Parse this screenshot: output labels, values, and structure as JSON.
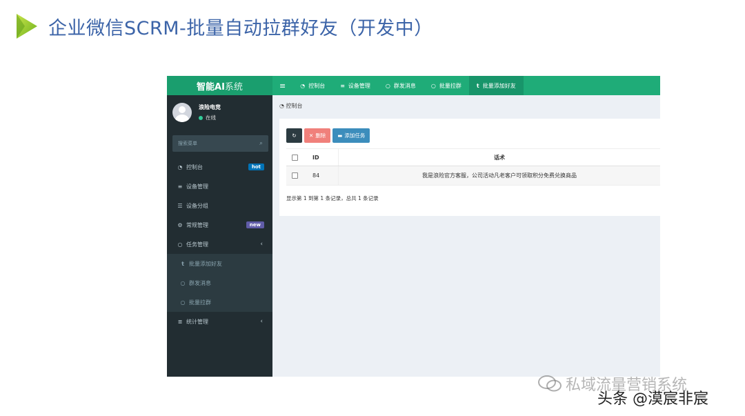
{
  "slide": {
    "title": "企业微信SCRM-批量自动拉群好友（开发中）",
    "accent": "#8fc31f"
  },
  "app": {
    "logo_bold": "智能AI",
    "logo_light": "系统",
    "user": {
      "name": "浪险电竞",
      "status": "在线"
    },
    "search_placeholder": "搜索菜单",
    "sidebar": {
      "dashboard": "控制台",
      "dashboard_badge": "hot",
      "device_mgmt": "设备管理",
      "device_group": "设备分组",
      "general_mgmt": "常规管理",
      "general_badge": "new",
      "task_mgmt": "任务管理",
      "sub_batch_add": "批量添加好友",
      "sub_group_msg": "群发消息",
      "sub_batch_pull": "批量拉群",
      "stats_mgmt": "统计管理"
    },
    "topbar": {
      "tabs": [
        "控制台",
        "设备管理",
        "群发消息",
        "批量拉群",
        "批量添加好友"
      ]
    },
    "breadcrumb": "控制台",
    "toolbar": {
      "delete": "删除",
      "add": "添加任务"
    },
    "table": {
      "headers": {
        "id": "ID",
        "script": "话术"
      },
      "rows": [
        {
          "id": "84",
          "script": "我是浪险官方客服，公司活动凡老客户可领取积分免费兑换商品"
        }
      ]
    },
    "pager": "显示第 1 到第 1 条记录，总共 1 条记录",
    "colors": {
      "sidebar": "#222d32",
      "topbar": "#1fac78",
      "hot": "#0073b7",
      "new": "#605ca8"
    }
  },
  "watermark": {
    "line1": "私域流量营销系统",
    "line2": "头条 @漠宸非宸"
  }
}
